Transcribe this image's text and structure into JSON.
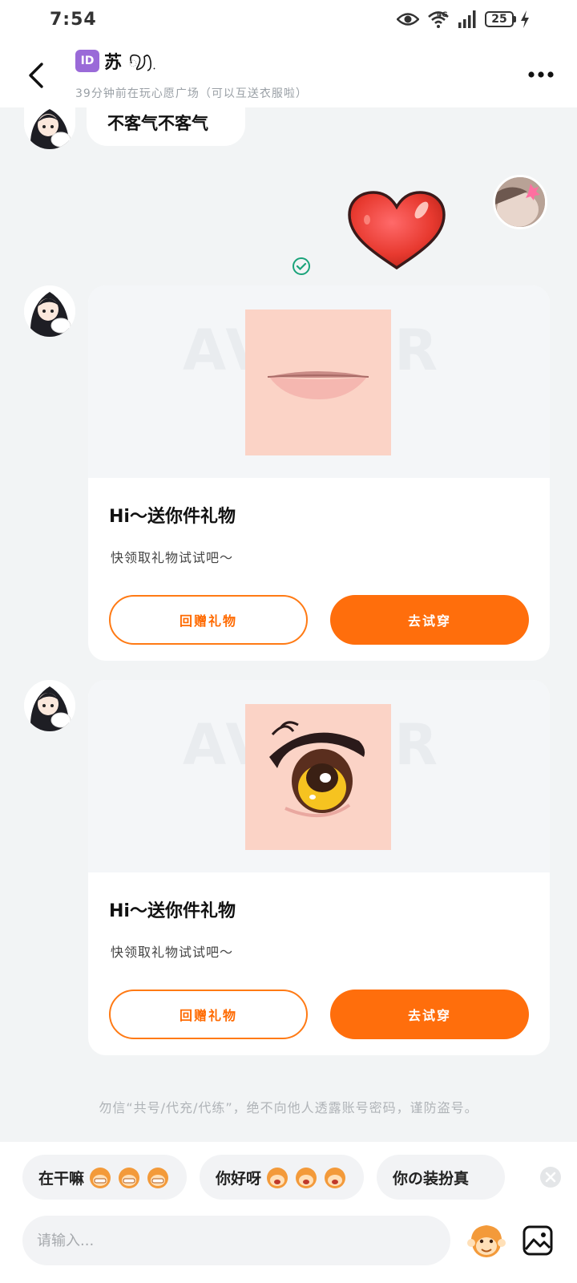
{
  "status_bar": {
    "time": "7:54",
    "battery": "25",
    "network": "4G"
  },
  "header": {
    "id_badge": "ID",
    "contact_name": "苏",
    "contact_status": "39分钟前在玩心愿广场（可以互送衣服啦）"
  },
  "messages": {
    "text_message": "不客气不客气"
  },
  "gift_cards": [
    {
      "watermark": "AVATAR",
      "title": "Hi～送你件礼物",
      "subtitle": "快领取礼物试试吧～",
      "return_label": "回赠礼物",
      "try_label": "去试穿",
      "item": "lips"
    },
    {
      "watermark": "AVATAR",
      "title": "Hi～送你件礼物",
      "subtitle": "快领取礼物试试吧～",
      "return_label": "回赠礼物",
      "try_label": "去试穿",
      "item": "eye"
    }
  ],
  "safety_notice": "勿信“共号/代充/代练”，绝不向他人透露账号密码，谨防盗号。",
  "quick_replies": [
    {
      "label": "在干嘛",
      "emoji_count": 3
    },
    {
      "label": "你好呀",
      "emoji_count": 3
    },
    {
      "label": "你の装扮真"
    }
  ],
  "input": {
    "placeholder": "请输入..."
  },
  "colors": {
    "accent": "#ff6e0c",
    "read_check": "#1aa37a",
    "id_badge": "#9a6ad8"
  }
}
